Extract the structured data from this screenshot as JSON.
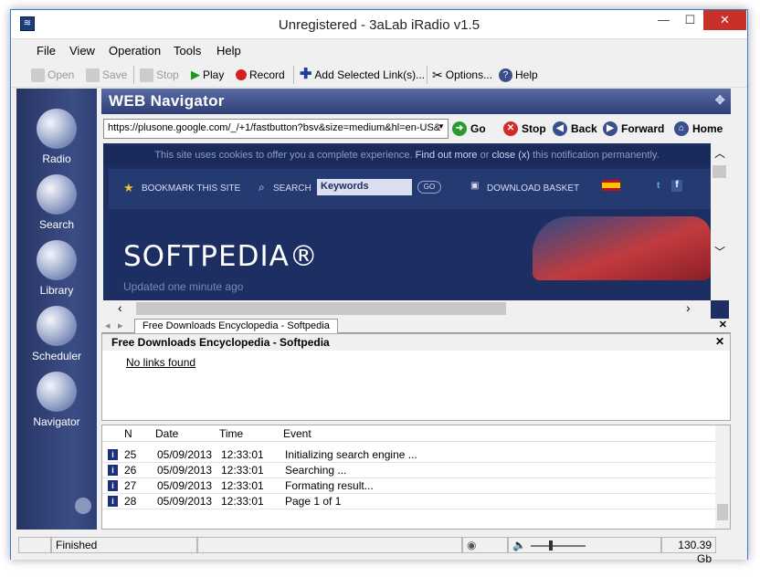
{
  "window": {
    "title": "Unregistered - 3aLab iRadio v1.5",
    "minimize": "—",
    "maximize": "☐",
    "close": "✕"
  },
  "menu": {
    "file": "File",
    "view": "View",
    "operation": "Operation",
    "tools": "Tools",
    "help": "Help"
  },
  "toolbar": {
    "open": "Open",
    "save": "Save",
    "stop": "Stop",
    "play": "Play",
    "record": "Record",
    "add_links": "Add Selected Link(s)...",
    "options": "Options...",
    "help": "Help"
  },
  "sidebar": {
    "radio": "Radio",
    "search": "Search",
    "library": "Library",
    "scheduler": "Scheduler",
    "navigator": "Navigator"
  },
  "navigator": {
    "title": "WEB Navigator",
    "url": "https://plusone.google.com/_/+1/fastbutton?bsv&size=medium&hl=en-US&",
    "go": "Go",
    "stop": "Stop",
    "back": "Back",
    "forward": "Forward",
    "home": "Home"
  },
  "webpage": {
    "cookie_notice": "This site uses cookies to offer you a complete experience.",
    "cookie_find_out": "Find out more",
    "cookie_or": "or",
    "cookie_close": "close (x)",
    "cookie_tail": "this notification permanently.",
    "bookmark": "BOOKMARK THIS SITE",
    "search": "SEARCH",
    "keywords": "Keywords",
    "go": "GO",
    "download_basket": "DOWNLOAD BASKET",
    "logo": "SOFTPEDIA®",
    "updated": "Updated one minute ago"
  },
  "tab": {
    "label": "Free Downloads Encyclopedia - Softpedia"
  },
  "links_panel": {
    "title": "Free Downloads Encyclopedia - Softpedia",
    "empty": "No links found"
  },
  "log": {
    "columns": [
      "N",
      "Date",
      "Time",
      "Event"
    ],
    "rows": [
      {
        "n": "25",
        "date": "05/09/2013",
        "time": "12:33:01",
        "event": "Initializing search engine ..."
      },
      {
        "n": "26",
        "date": "05/09/2013",
        "time": "12:33:01",
        "event": "Searching ..."
      },
      {
        "n": "27",
        "date": "05/09/2013",
        "time": "12:33:01",
        "event": "Formating result..."
      },
      {
        "n": "28",
        "date": "05/09/2013",
        "time": "12:33:01",
        "event": "Page 1 of 1"
      }
    ]
  },
  "status": {
    "text": "Finished",
    "disk": "130.39 Gb"
  }
}
